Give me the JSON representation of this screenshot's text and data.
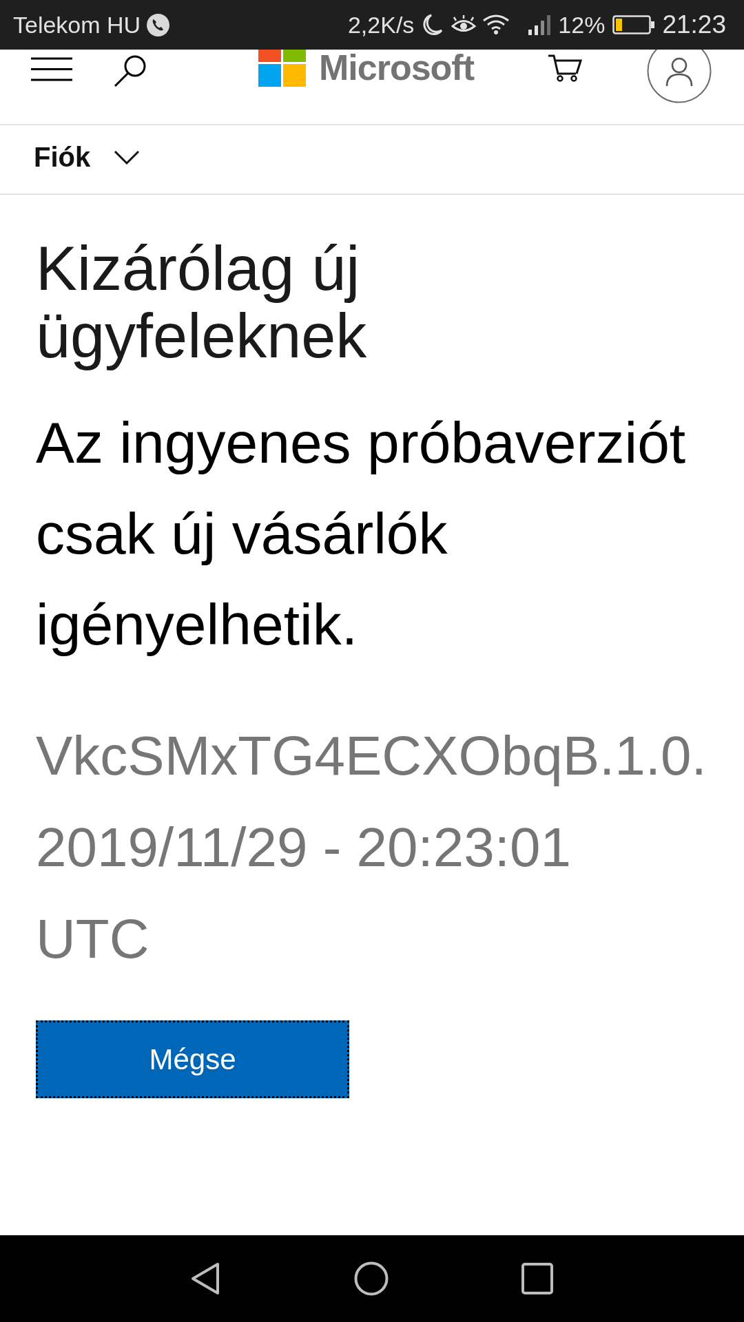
{
  "status_bar": {
    "carrier": "Telekom HU",
    "network_speed": "2,2K/s",
    "battery_percent": "12%",
    "time": "21:23"
  },
  "header": {
    "brand": "Microsoft"
  },
  "breadcrumb": {
    "label": "Fiók",
    "expanded": false
  },
  "content": {
    "title": "Kizárólag új ügyfeleknek",
    "message": "Az ingyenes próbaverziót csak új vásárlók igényelhetik.",
    "reference_code": "VkcSMxTG4ECXObqB.1.0.",
    "timestamp": "2019/11/29 - 20:23:01 UTC"
  },
  "buttons": [
    {
      "label": "Mégse",
      "focused": true
    }
  ]
}
